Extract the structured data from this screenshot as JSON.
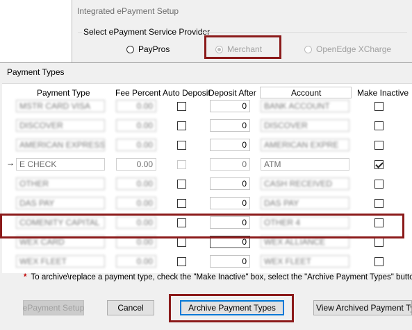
{
  "background_window": {
    "title": "Integrated ePayment Setup",
    "group_label": "Select ePayment Service Provider",
    "providers": [
      {
        "label": "PayPros",
        "selected": false,
        "enabled": true
      },
      {
        "label": "Merchant",
        "selected": true,
        "enabled": false
      },
      {
        "label": "OpenEdge XCharge",
        "selected": false,
        "enabled": false
      }
    ]
  },
  "dialog": {
    "title": "Payment Types",
    "columns": [
      "Payment Type",
      "Fee Percent",
      "Auto Deposit",
      "Deposit After",
      "Account",
      "Make Inactive"
    ],
    "rows": [
      {
        "type": "MSTR CARD VISA",
        "fee": "0.00",
        "auto_deposit": false,
        "deposit_after": "0",
        "account": "BANK ACCOUNT",
        "inactive": false,
        "blurred": true
      },
      {
        "type": "DISCOVER",
        "fee": "0.00",
        "auto_deposit": false,
        "deposit_after": "0",
        "account": "DISCOVER",
        "inactive": false,
        "blurred": true
      },
      {
        "type": "AMERICAN EXPRESS",
        "fee": "0.00",
        "auto_deposit": false,
        "deposit_after": "0",
        "account": "AMERICAN EXPRE",
        "inactive": false,
        "blurred": true
      },
      {
        "type": "E CHECK",
        "fee": "0.00",
        "auto_deposit": false,
        "deposit_after": "0",
        "account": "ATM",
        "inactive": true,
        "blurred": false,
        "current": true
      },
      {
        "type": "OTHER",
        "fee": "0.00",
        "auto_deposit": false,
        "deposit_after": "0",
        "account": "CASH RECEIVED",
        "inactive": false,
        "blurred": true
      },
      {
        "type": "DAS PAY",
        "fee": "0.00",
        "auto_deposit": false,
        "deposit_after": "0",
        "account": "DAS PAY",
        "inactive": false,
        "blurred": true
      },
      {
        "type": "COMENITY CAPITAL",
        "fee": "0.00",
        "auto_deposit": false,
        "deposit_after": "0",
        "account": "OTHER 4",
        "inactive": false,
        "blurred": true
      },
      {
        "type": "WEX CARD",
        "fee": "0.00",
        "auto_deposit": false,
        "deposit_after": "0",
        "account": "WEX ALLIANCE",
        "inactive": false,
        "blurred": true
      },
      {
        "type": "WEX FLEET",
        "fee": "0.00",
        "auto_deposit": false,
        "deposit_after": "0",
        "account": "WEX FLEET",
        "inactive": false,
        "blurred": true
      }
    ],
    "row_marker": "→",
    "note_star": "*",
    "note": "To archive\\replace a payment type, check the \"Make Inactive\" box, select the \"Archive Payment Types\" button.",
    "buttons": {
      "epayment_setup": "ePayment Setup",
      "cancel": "Cancel",
      "archive": "Archive Payment Types",
      "view_archived": "View Archived Payment Type"
    }
  },
  "colors": {
    "highlight": "#8b1a1a",
    "dialog_bg": "#f0f0f0",
    "note_star": "#c00000"
  }
}
